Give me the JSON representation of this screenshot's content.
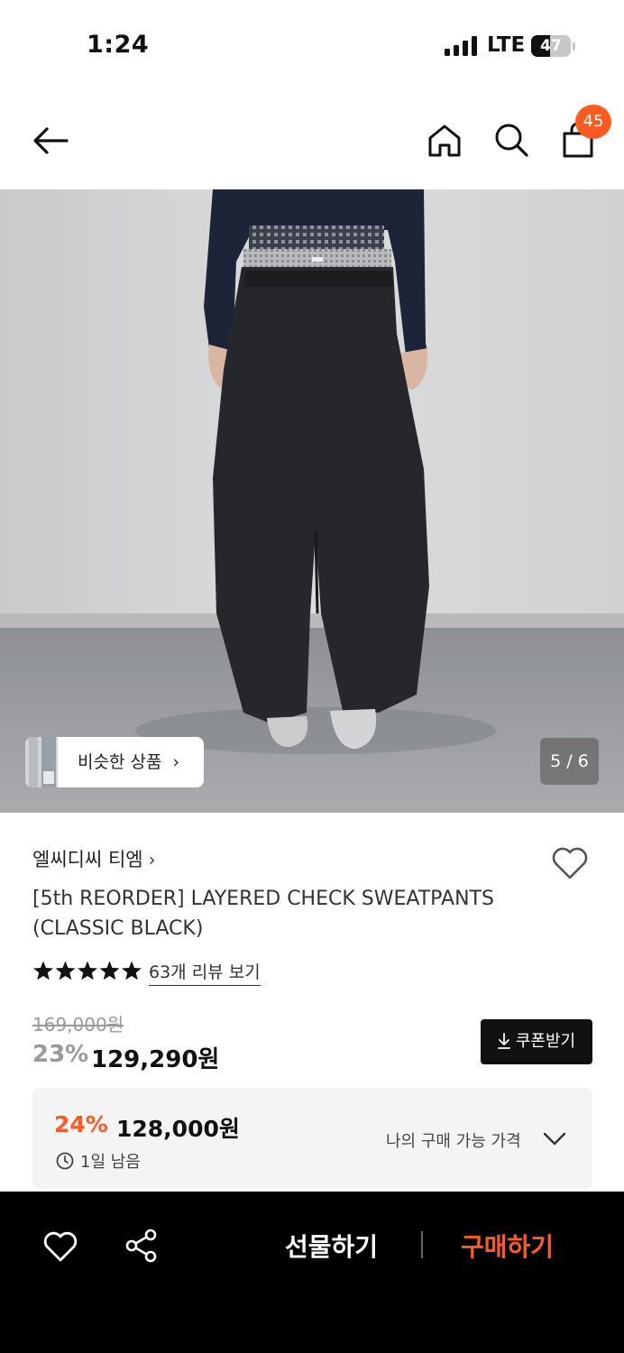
{
  "status_bar": {
    "time": "1:24",
    "network": "LTE",
    "battery": "47",
    "battery_fraction": 0.47
  },
  "nav": {
    "icons": [
      "back-arrow-icon",
      "home-icon",
      "search-icon",
      "shopping-bag-icon"
    ],
    "cart_badge": "45",
    "accent_color": "#ff5a1f"
  },
  "gallery": {
    "similar_button": "비슷한 상품",
    "pager": "5 / 6"
  },
  "product": {
    "brand": "엘씨디씨 티엠",
    "title": "[5th REORDER] LAYERED CHECK SWEATPANTS (CLASSIC BLACK)",
    "rating_stars": 5,
    "review_link": "63개 리뷰 보기",
    "original_price": "169,000원",
    "discount": "23%",
    "price": "129,290원",
    "coupon_button": "쿠폰받기"
  },
  "best_price": {
    "discount": "24%",
    "price": "128,000원",
    "remaining": "1일 남음",
    "my_price_label": "나의 구매 가능 가격"
  },
  "bottom_bar": {
    "gift_button": "선물하기",
    "buy_button": "구매하기",
    "buy_color": "#ff5a1f"
  }
}
